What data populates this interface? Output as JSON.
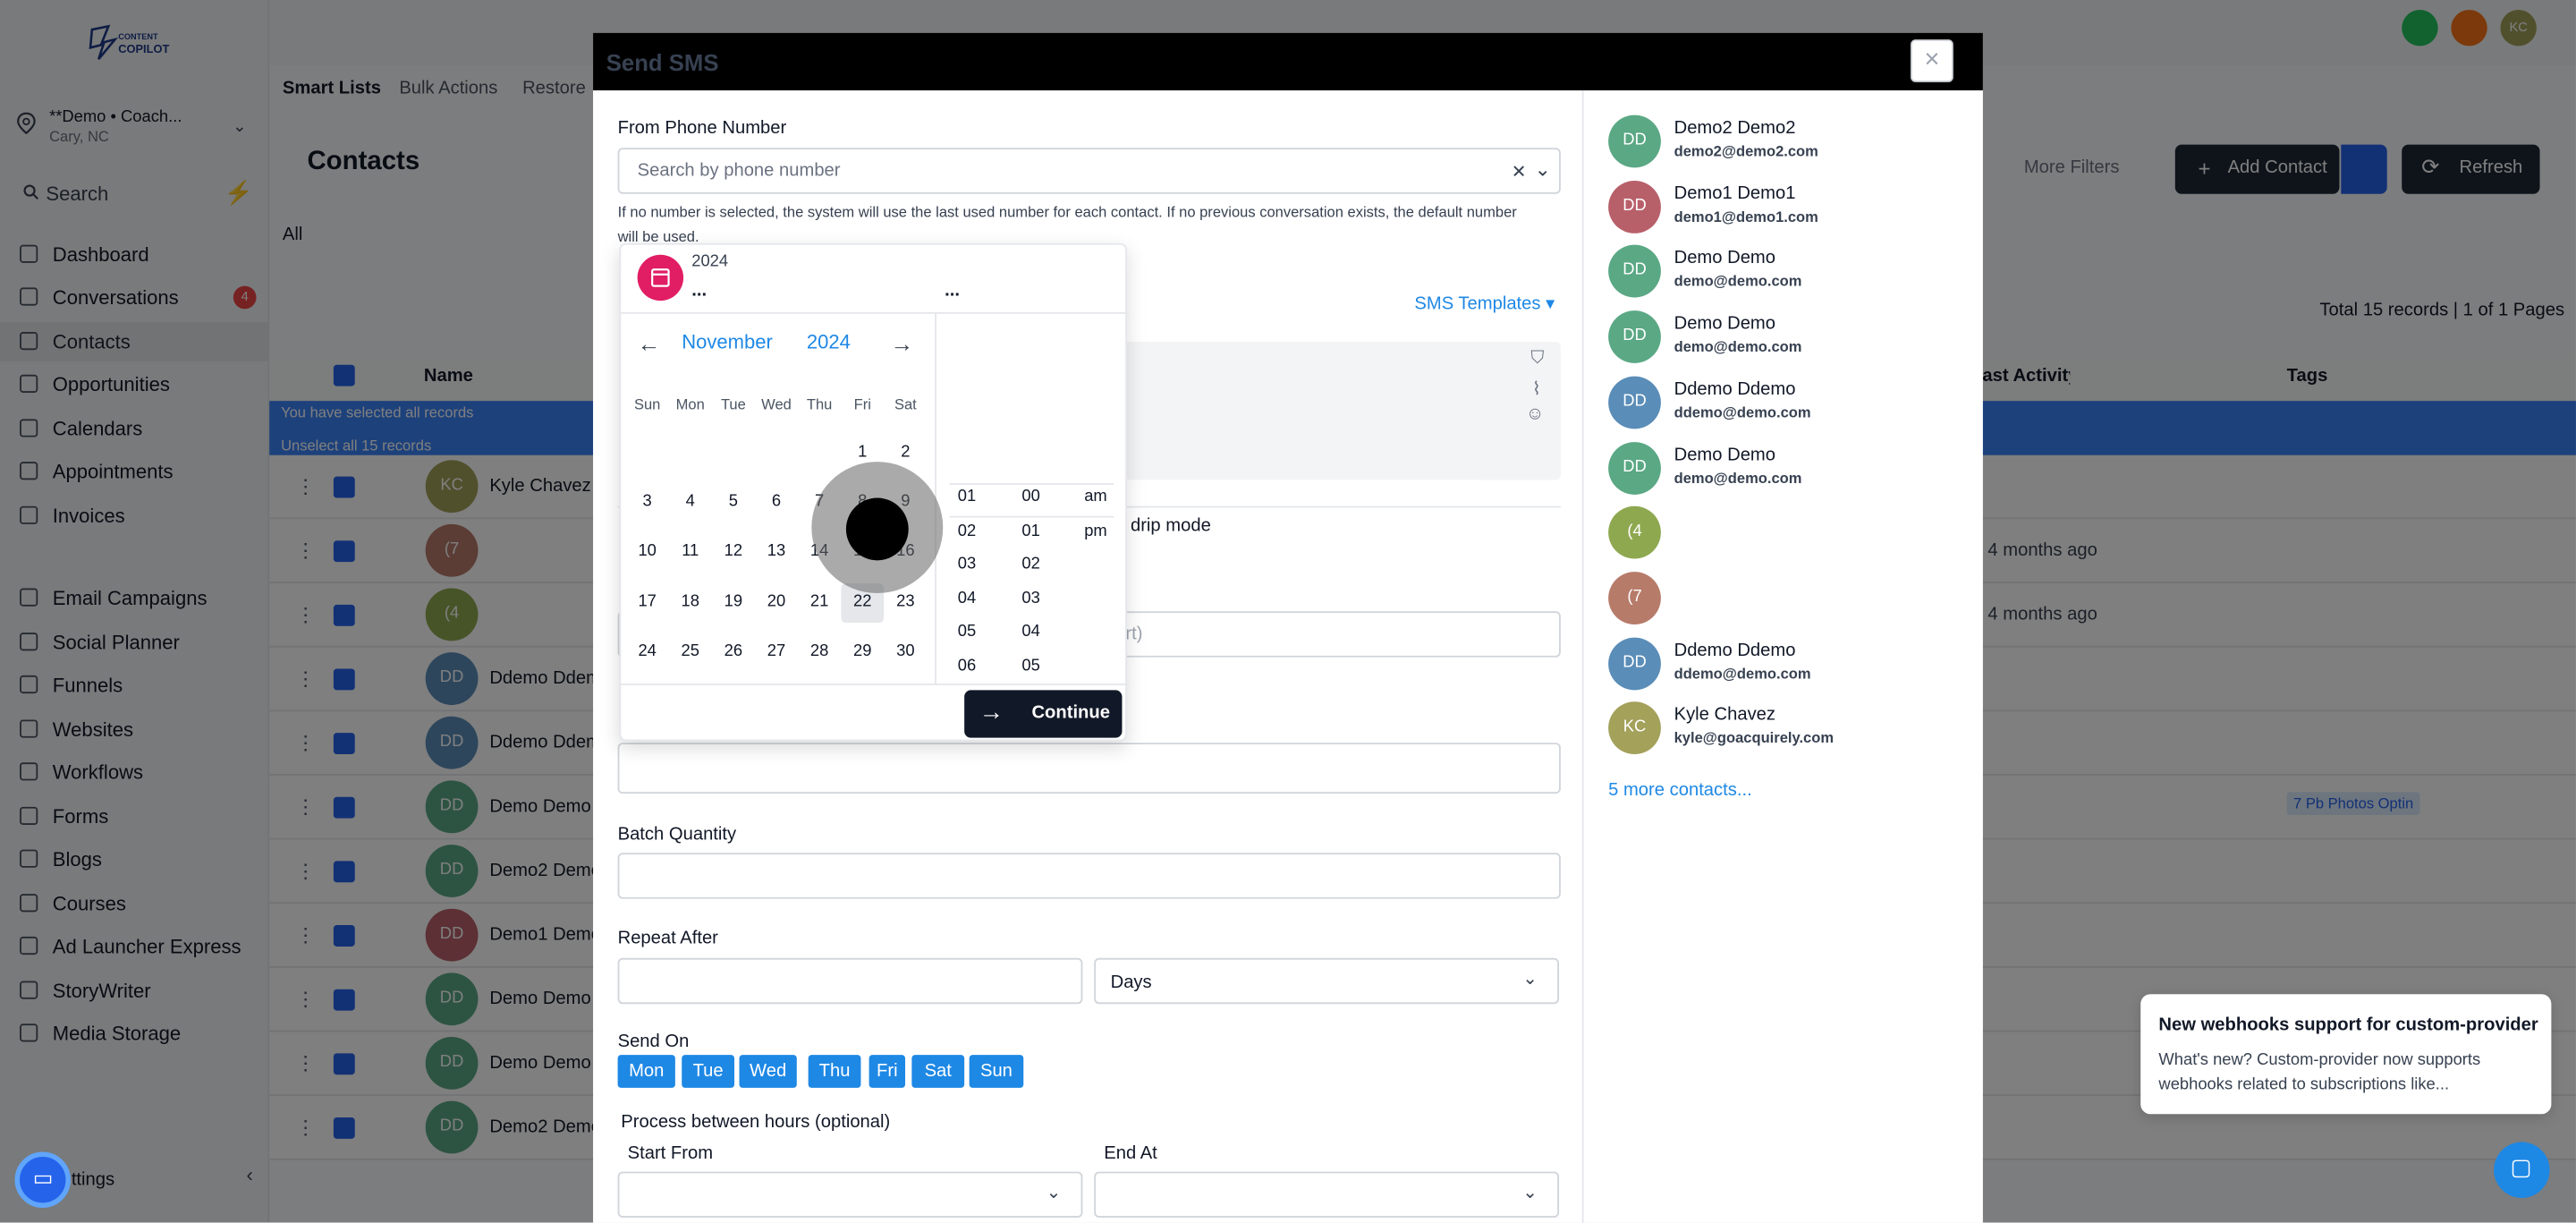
{
  "app": {
    "logo_text": "CONTENT COPILOT"
  },
  "sidebar": {
    "location_name": "**Demo • Coach...",
    "location_sub": "Cary, NC",
    "search_label": "Search",
    "items": [
      {
        "label": "Dashboard",
        "icon": "dashboard-icon"
      },
      {
        "label": "Conversations",
        "icon": "chat-icon",
        "badge": "4"
      },
      {
        "label": "Contacts",
        "icon": "user-icon",
        "active": true
      },
      {
        "label": "Opportunities",
        "icon": "funnel-icon"
      },
      {
        "label": "Calendars",
        "icon": "calendar-icon"
      },
      {
        "label": "Appointments",
        "icon": "list-icon"
      },
      {
        "label": "Invoices",
        "icon": "invoice-icon"
      },
      {
        "label": "Email Campaigns",
        "icon": "email-icon"
      },
      {
        "label": "Social Planner",
        "icon": "social-icon"
      },
      {
        "label": "Funnels",
        "icon": "funnel-icon"
      },
      {
        "label": "Websites",
        "icon": "website-icon"
      },
      {
        "label": "Workflows",
        "icon": "workflow-icon"
      },
      {
        "label": "Forms",
        "icon": "form-icon"
      },
      {
        "label": "Blogs",
        "icon": "blog-icon"
      },
      {
        "label": "Courses",
        "icon": "course-icon"
      },
      {
        "label": "Ad Launcher Express",
        "icon": "rocket-icon"
      },
      {
        "label": "StoryWriter",
        "icon": "book-icon"
      },
      {
        "label": "Media Storage",
        "icon": "image-icon"
      }
    ],
    "settings_label": "Settings"
  },
  "page": {
    "tabs": [
      "Smart Lists",
      "Bulk Actions",
      "Restore"
    ],
    "title": "Contacts",
    "all_tab": "All",
    "more_filters": "More Filters",
    "add_contact": "Add Contact",
    "refresh": "Refresh",
    "total_records": "Total 15 records | 1 of 1 Pages",
    "col_name": "Name",
    "col_activity": "Last Activity",
    "col_tags": "Tags",
    "selection_note": "You have selected all records",
    "unselect": "Unselect all 15 records",
    "rows": [
      {
        "initials": "KC",
        "name": "Kyle Chavez",
        "activity": "",
        "color": "#a3a15a"
      },
      {
        "initials": "(7",
        "name": "",
        "activity": "4 months ago",
        "color": "#b77b6a"
      },
      {
        "initials": "(4",
        "name": "",
        "activity": "4 months ago",
        "color": "#8ea850"
      },
      {
        "initials": "DD",
        "name": "Ddemo Ddemo",
        "activity": "",
        "color": "#5a8db8"
      },
      {
        "initials": "DD",
        "name": "Ddemo Ddemo",
        "activity": "",
        "color": "#5a8db8"
      },
      {
        "initials": "DD",
        "name": "Demo Demo",
        "activity": "",
        "color": "#5aa884",
        "tag": "7 Pb Photos Optin"
      },
      {
        "initials": "DD",
        "name": "Demo2 Demo2",
        "activity": "",
        "color": "#5aa884"
      },
      {
        "initials": "DD",
        "name": "Demo1 Demo1",
        "activity": "",
        "color": "#b8606a"
      },
      {
        "initials": "DD",
        "name": "Demo Demo",
        "activity": "",
        "color": "#5aa884"
      },
      {
        "initials": "DD",
        "name": "Demo Demo",
        "activity": "",
        "color": "#5aa884"
      },
      {
        "initials": "DD",
        "name": "Demo2 Demo2",
        "activity": "",
        "color": "#5aa884"
      }
    ]
  },
  "modal": {
    "title": "Send SMS",
    "close": "×",
    "from_label": "From Phone Number",
    "from_placeholder": "Search by phone number",
    "from_help": "If no number is selected, the system will use the last used number for each contact. If no previous conversation exists, the default number will be used.",
    "templates": "SMS Templates",
    "drip_text": "n drip mode",
    "start_placeholder": "ort)",
    "batch_label": "Batch Quantity",
    "repeat_label": "Repeat After",
    "repeat_unit": "Days",
    "send_on_label": "Send On",
    "days": [
      "Mon",
      "Tue",
      "Wed",
      "Thu",
      "Fri",
      "Sat",
      "Sun"
    ],
    "hours_label": "Process between hours (optional)",
    "start_from": "Start From",
    "end_at": "End At"
  },
  "picker": {
    "year_top": "2024",
    "dots": "...",
    "month": "November",
    "year": "2024",
    "dow": [
      "Sun",
      "Mon",
      "Tue",
      "Wed",
      "Thu",
      "Fri",
      "Sat"
    ],
    "weeks": [
      [
        "",
        "",
        "",
        "",
        "",
        "1",
        "2"
      ],
      [
        "3",
        "4",
        "5",
        "6",
        "7",
        "8",
        "9"
      ],
      [
        "10",
        "11",
        "12",
        "13",
        "14",
        "15",
        "16"
      ],
      [
        "17",
        "18",
        "19",
        "20",
        "21",
        "22",
        "23"
      ],
      [
        "24",
        "25",
        "26",
        "27",
        "28",
        "29",
        "30"
      ]
    ],
    "selected_day": "22",
    "hours": [
      "01",
      "02",
      "03",
      "04",
      "05",
      "06"
    ],
    "minutes": [
      "00",
      "01",
      "02",
      "03",
      "04",
      "05"
    ],
    "ampm": [
      "am",
      "pm"
    ],
    "continue": "Continue"
  },
  "recipients": [
    {
      "initials": "DD",
      "name": "Demo2 Demo2",
      "email": "demo2@demo2.com",
      "color": "#5aa884"
    },
    {
      "initials": "DD",
      "name": "Demo1 Demo1",
      "email": "demo1@demo1.com",
      "color": "#b8606a"
    },
    {
      "initials": "DD",
      "name": "Demo Demo",
      "email": "demo@demo.com",
      "color": "#5aa884"
    },
    {
      "initials": "DD",
      "name": "Demo Demo",
      "email": "demo@demo.com",
      "color": "#5aa884"
    },
    {
      "initials": "DD",
      "name": "Ddemo Ddemo",
      "email": "ddemo@demo.com",
      "color": "#5a8db8"
    },
    {
      "initials": "DD",
      "name": "Demo Demo",
      "email": "demo@demo.com",
      "color": "#5aa884"
    },
    {
      "initials": "(4",
      "name": "",
      "email": "",
      "color": "#8ea850"
    },
    {
      "initials": "(7",
      "name": "",
      "email": "",
      "color": "#b77b6a"
    },
    {
      "initials": "DD",
      "name": "Ddemo Ddemo",
      "email": "ddemo@demo.com",
      "color": "#5a8db8"
    },
    {
      "initials": "KC",
      "name": "Kyle Chavez",
      "email": "kyle@goacquirely.com",
      "color": "#a3a15a"
    }
  ],
  "more_contacts": "5 more contacts...",
  "toast": {
    "title": "New webhooks support for custom-provider",
    "body": "What's new? Custom-provider now supports webhooks related to subscriptions like..."
  },
  "colors": {
    "accent": "#1e88e5",
    "primary_dark": "#1f2937",
    "calendar_icon": "#e11d63"
  }
}
